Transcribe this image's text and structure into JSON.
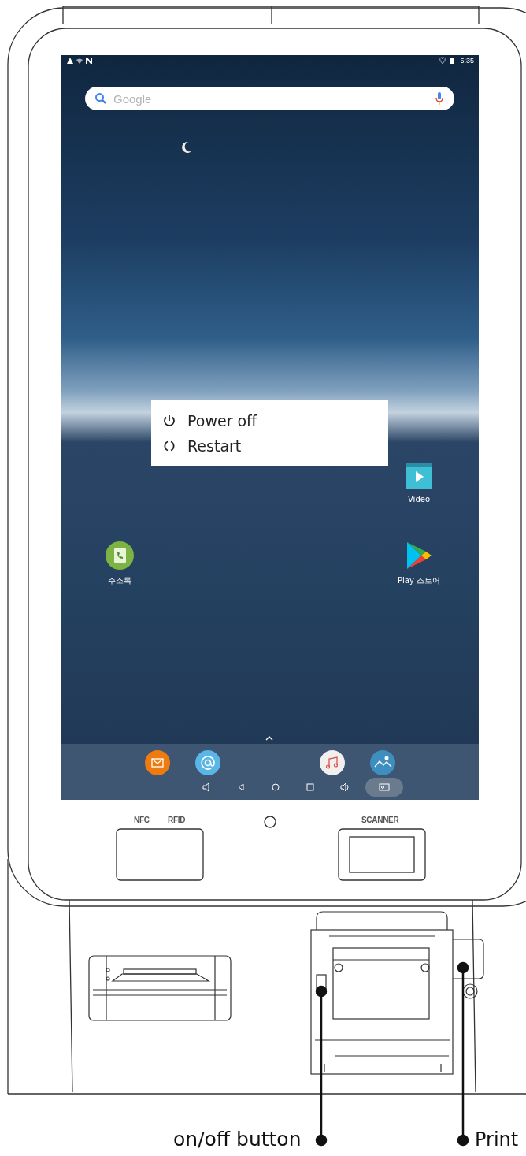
{
  "status_bar": {
    "time": "5:35"
  },
  "search": {
    "placeholder": "Google"
  },
  "power_menu": {
    "power_off": "Power off",
    "restart": "Restart"
  },
  "home_apps": {
    "video": {
      "label": "Video"
    },
    "contacts": {
      "label": "주소록"
    },
    "play_store": {
      "label": "Play 스토어"
    }
  },
  "device_labels": {
    "nfc": "NFC",
    "rfid": "RFID",
    "scanner": "SCANNER"
  },
  "callouts": [
    {
      "label": "on/off button"
    },
    {
      "label": "Print"
    }
  ]
}
